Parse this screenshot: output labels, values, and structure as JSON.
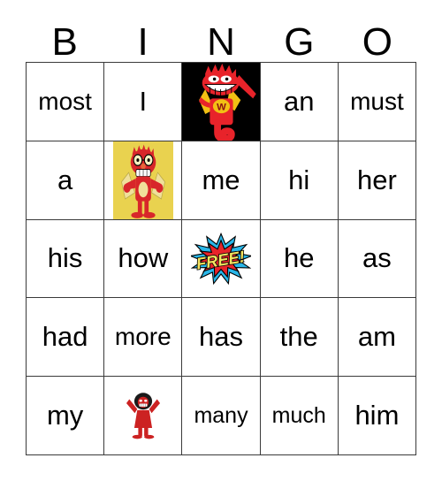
{
  "card": {
    "type": "bingo-card",
    "header_letters": [
      "B",
      "I",
      "N",
      "G",
      "O"
    ],
    "columns": 5,
    "rows": 5,
    "border_color": "#3a3a3a",
    "background_color": "#ffffff",
    "text_color": "#000000"
  },
  "free_space": {
    "label": "FREE!",
    "position": "row3-col3",
    "burst_outer_color": "#29b6e8",
    "burst_inner_color": "#e8232a",
    "text_color": "#f5e45f",
    "outline_color": "#000000"
  },
  "images": {
    "devil_black": {
      "name": "red-devil-mascot-black-bg",
      "background": "#000000",
      "body_color": "#e8232a",
      "cape_color": "#f2c014",
      "emblem_letter": "W"
    },
    "devil_yellow": {
      "name": "red-mascot-glasses-yellow-bg",
      "background": "#e9d24f",
      "body_color": "#d8262a",
      "cape_color": "#f0e09a"
    },
    "figure_small": {
      "name": "red-figure-arms-up",
      "background": "#ffffff",
      "body_color": "#cc2222",
      "hair_color": "#1a1a1a"
    }
  },
  "grid": [
    [
      {
        "kind": "text",
        "value": "most",
        "size": "sz-4"
      },
      {
        "kind": "text",
        "value": "I",
        "size": ""
      },
      {
        "kind": "image",
        "value": "devil_black"
      },
      {
        "kind": "text",
        "value": "an",
        "size": ""
      },
      {
        "kind": "text",
        "value": "must",
        "size": "sz-4"
      }
    ],
    [
      {
        "kind": "text",
        "value": "a",
        "size": ""
      },
      {
        "kind": "image",
        "value": "devil_yellow"
      },
      {
        "kind": "text",
        "value": "me",
        "size": ""
      },
      {
        "kind": "text",
        "value": "hi",
        "size": ""
      },
      {
        "kind": "text",
        "value": "her",
        "size": ""
      }
    ],
    [
      {
        "kind": "text",
        "value": "his",
        "size": ""
      },
      {
        "kind": "text",
        "value": "how",
        "size": ""
      },
      {
        "kind": "free",
        "value": "FREE!"
      },
      {
        "kind": "text",
        "value": "he",
        "size": ""
      },
      {
        "kind": "text",
        "value": "as",
        "size": ""
      }
    ],
    [
      {
        "kind": "text",
        "value": "had",
        "size": ""
      },
      {
        "kind": "text",
        "value": "more",
        "size": "sz-4"
      },
      {
        "kind": "text",
        "value": "has",
        "size": ""
      },
      {
        "kind": "text",
        "value": "the",
        "size": ""
      },
      {
        "kind": "text",
        "value": "am",
        "size": ""
      }
    ],
    [
      {
        "kind": "text",
        "value": "my",
        "size": ""
      },
      {
        "kind": "image",
        "value": "figure_small"
      },
      {
        "kind": "text",
        "value": "many",
        "size": "sz-5"
      },
      {
        "kind": "text",
        "value": "much",
        "size": "sz-5"
      },
      {
        "kind": "text",
        "value": "him",
        "size": ""
      }
    ]
  ]
}
